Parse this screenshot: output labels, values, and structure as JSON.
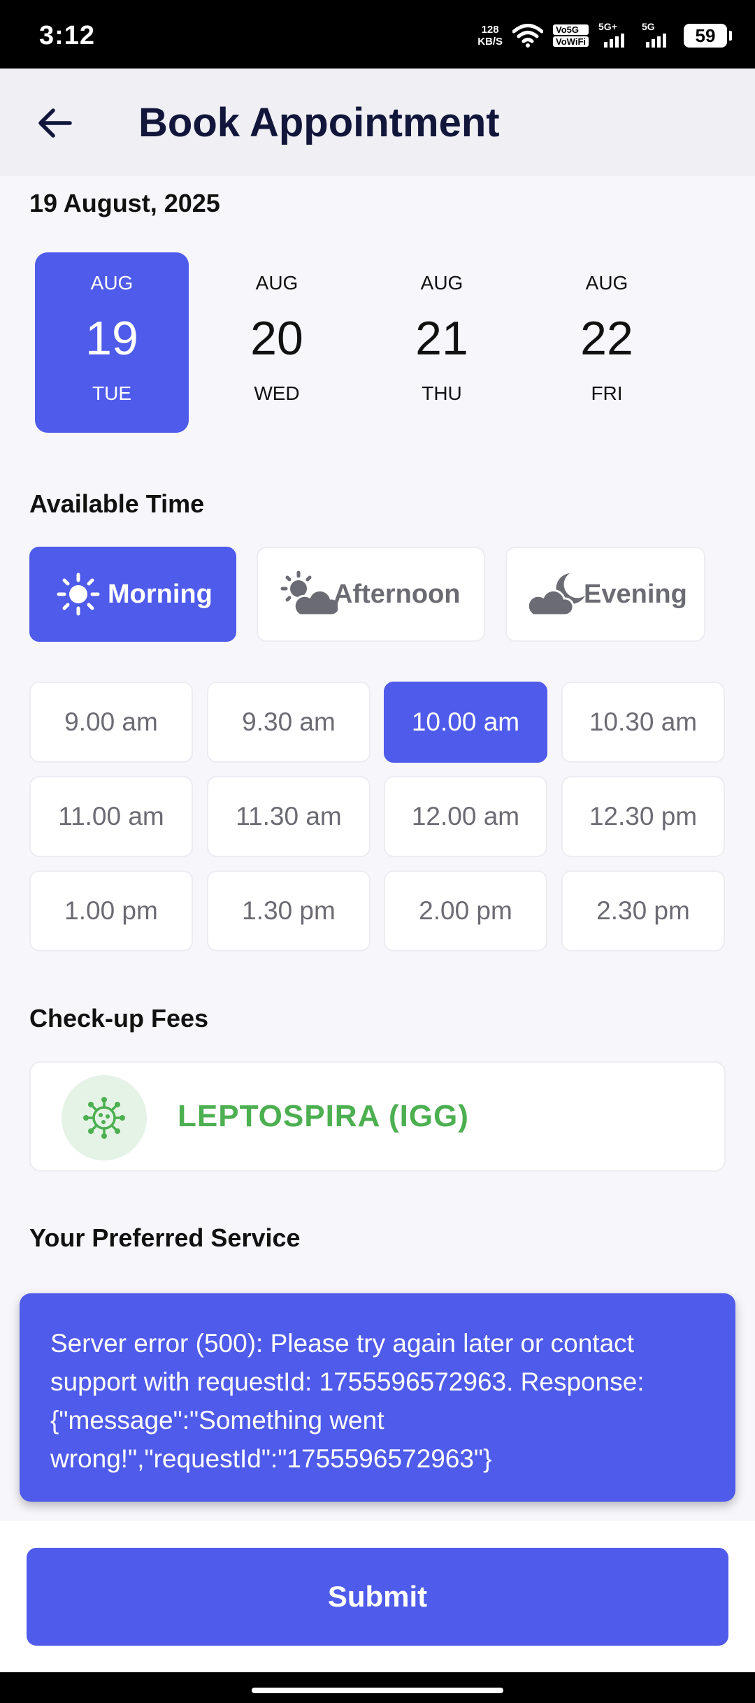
{
  "status_bar": {
    "time": "3:12",
    "net_speed_value": "128",
    "net_speed_unit": "KB/S",
    "volte_top": "Vo5G",
    "volte_bottom": "VoWiFi",
    "sim1_label": "5G+",
    "sim2_label": "5G",
    "battery": "59"
  },
  "app_bar": {
    "title": "Book Appointment",
    "back_icon": "arrow-left-icon"
  },
  "date_heading": "19 August, 2025",
  "dates": [
    {
      "month": "AUG",
      "day": "19",
      "weekday": "TUE",
      "selected": true
    },
    {
      "month": "AUG",
      "day": "20",
      "weekday": "WED",
      "selected": false
    },
    {
      "month": "AUG",
      "day": "21",
      "weekday": "THU",
      "selected": false
    },
    {
      "month": "AUG",
      "day": "22",
      "weekday": "FRI",
      "selected": false
    }
  ],
  "available_time_title": "Available Time",
  "periods": [
    {
      "label": "Morning",
      "icon": "sun-icon",
      "selected": true
    },
    {
      "label": "Afternoon",
      "icon": "sun-cloud-icon",
      "selected": false
    },
    {
      "label": "Evening",
      "icon": "moon-cloud-icon",
      "selected": false
    }
  ],
  "time_slots": [
    {
      "label": "9.00 am",
      "selected": false
    },
    {
      "label": "9.30 am",
      "selected": false
    },
    {
      "label": "10.00 am",
      "selected": true
    },
    {
      "label": "10.30 am",
      "selected": false
    },
    {
      "label": "11.00 am",
      "selected": false
    },
    {
      "label": "11.30 am",
      "selected": false
    },
    {
      "label": "12.00 am",
      "selected": false
    },
    {
      "label": "12.30 pm",
      "selected": false
    },
    {
      "label": "1.00 pm",
      "selected": false
    },
    {
      "label": "1.30 pm",
      "selected": false
    },
    {
      "label": "2.00 pm",
      "selected": false
    },
    {
      "label": "2.30 pm",
      "selected": false
    }
  ],
  "checkup_fees_title": "Check-up Fees",
  "fee_item": {
    "name": "LEPTOSPIRA (IGG)",
    "icon": "virus-icon"
  },
  "preferred_service_title": "Your Preferred Service",
  "snackbar": {
    "line1": "Server error (500): Please try again later or contact",
    "line2": "support with requestId: 1755596572963. Response:",
    "line3": "{\"message\":\"Something went",
    "line4": "wrong!\",\"requestId\":\"1755596572963\"}"
  },
  "submit_label": "Submit",
  "colors": {
    "primary": "#4f5bea",
    "title": "#11163a",
    "fee_green": "#4caf50",
    "background": "#f6f6fb"
  }
}
